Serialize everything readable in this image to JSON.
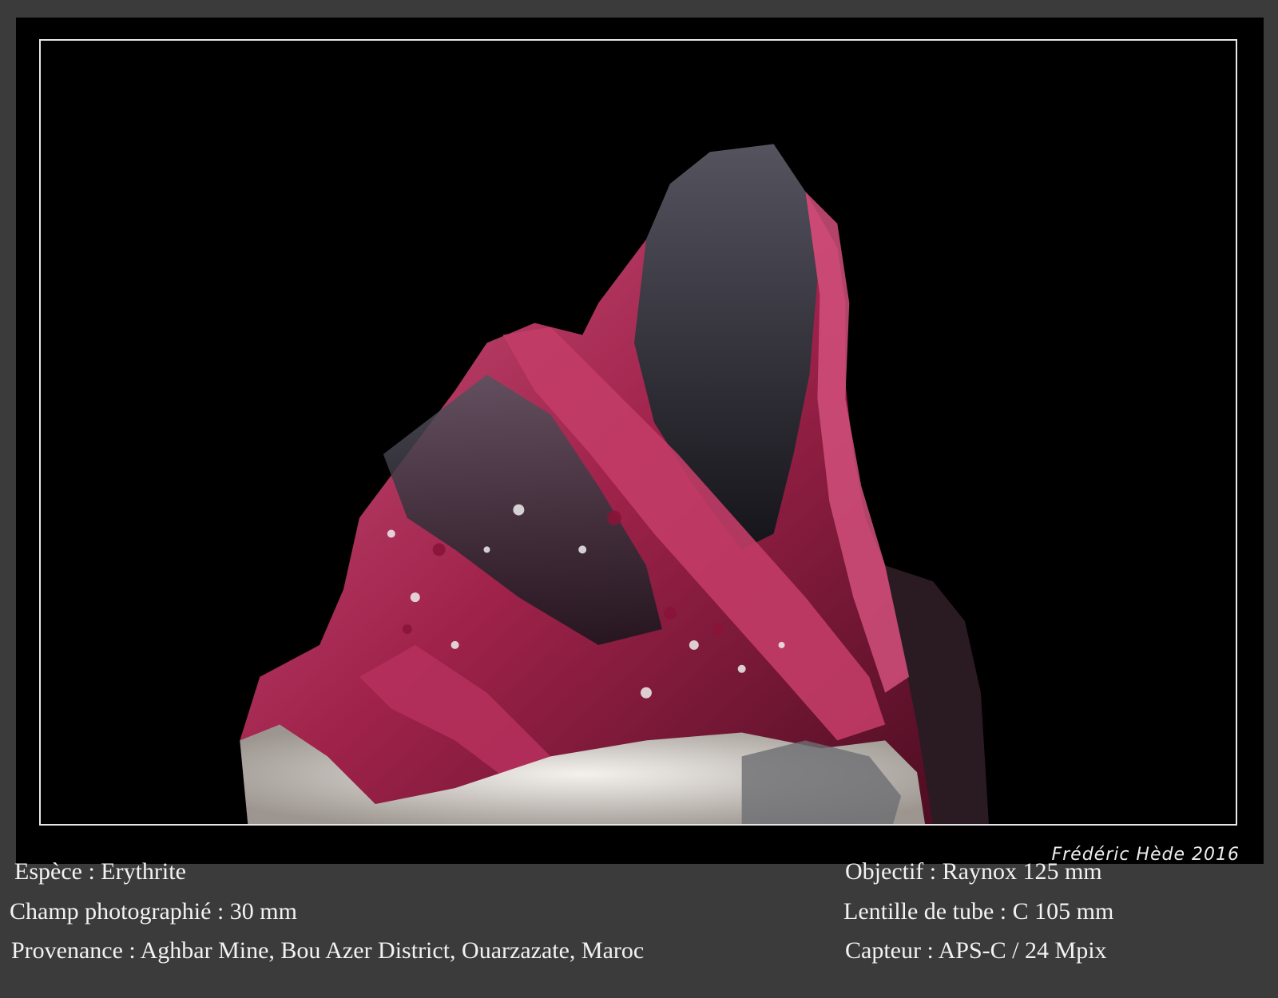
{
  "signature": "Frédéric Hède 2016",
  "caption": {
    "left": [
      "Espèce : Erythrite",
      "Champ photographié : 30 mm",
      "Provenance : Aghbar Mine, Bou Azer District, Ouarzazate, Maroc"
    ],
    "right": [
      "Objectif : Raynox 125 mm",
      "Lentille de tube : C 105 mm",
      "Capteur : APS-C / 24 Mpix"
    ]
  },
  "colors": {
    "background": "#3b3b3b",
    "frame": "#000000",
    "crystal": "#a8244f",
    "crystal_light": "#d9608a",
    "matrix": "#e6e1dc"
  }
}
